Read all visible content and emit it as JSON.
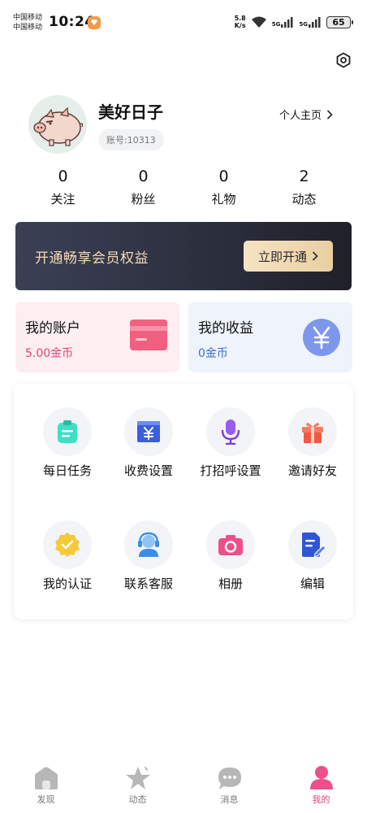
{
  "status_bar": {
    "carrier_1": "中国移动",
    "carrier_2": "中国移动",
    "time": "10:24",
    "speed_value": "5.8",
    "speed_unit": "K/s",
    "net_1": "5G",
    "net_2": "5G",
    "battery": "65"
  },
  "profile": {
    "username": "美好日子",
    "account_label": "账号:10313",
    "homepage_link": "个人主页"
  },
  "stats": [
    {
      "value": "0",
      "label": "关注"
    },
    {
      "value": "0",
      "label": "粉丝"
    },
    {
      "value": "0",
      "label": "礼物"
    },
    {
      "value": "2",
      "label": "动态"
    }
  ],
  "vip": {
    "text": "开通畅享会员权益",
    "button": "立即开通"
  },
  "cards": {
    "account": {
      "title": "我的账户",
      "value": "5.00金币"
    },
    "earnings": {
      "title": "我的收益",
      "value": "0金币"
    }
  },
  "grid": [
    {
      "label": "每日任务",
      "icon": "daily-task-icon"
    },
    {
      "label": "收费设置",
      "icon": "fee-settings-icon"
    },
    {
      "label": "打招呼设置",
      "icon": "greeting-mic-icon"
    },
    {
      "label": "邀请好友",
      "icon": "gift-icon"
    },
    {
      "label": "我的认证",
      "icon": "verified-badge-icon"
    },
    {
      "label": "联系客服",
      "icon": "customer-service-icon"
    },
    {
      "label": "相册",
      "icon": "camera-icon"
    },
    {
      "label": "编辑",
      "icon": "edit-document-icon"
    }
  ],
  "nav": [
    {
      "label": "发现",
      "icon": "home-icon",
      "active": false
    },
    {
      "label": "动态",
      "icon": "star-icon",
      "active": false
    },
    {
      "label": "消息",
      "icon": "chat-bubble-icon",
      "active": false
    },
    {
      "label": "我的",
      "icon": "person-icon",
      "active": true
    }
  ],
  "colors": {
    "accent_pink": "#e2457a",
    "vip_gold": "#f3d9b6",
    "earn_blue": "#3c6fd1"
  }
}
